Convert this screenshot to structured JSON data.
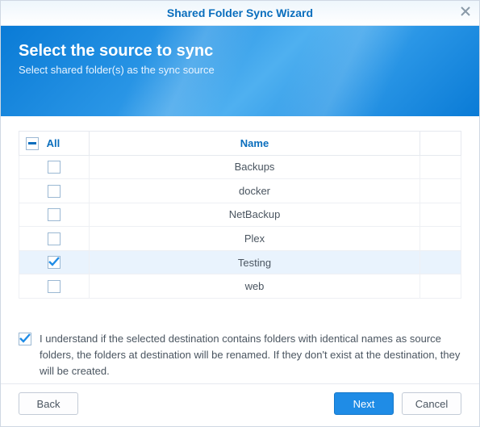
{
  "window": {
    "title": "Shared Folder Sync Wizard"
  },
  "hero": {
    "heading": "Select the source to sync",
    "sub": "Select shared folder(s) as the sync source"
  },
  "table": {
    "colAll": "All",
    "colName": "Name",
    "headerState": "indeterminate",
    "rows": [
      {
        "name": "Backups",
        "checked": false
      },
      {
        "name": "docker",
        "checked": false
      },
      {
        "name": "NetBackup",
        "checked": false
      },
      {
        "name": "Plex",
        "checked": false
      },
      {
        "name": "Testing",
        "checked": true
      },
      {
        "name": "web",
        "checked": false
      }
    ]
  },
  "ack": {
    "checked": true,
    "text": "I understand if the selected destination contains folders with identical names as source folders, the folders at destination will be renamed. If they don't exist at the destination, they will be created."
  },
  "buttons": {
    "back": "Back",
    "next": "Next",
    "cancel": "Cancel"
  }
}
